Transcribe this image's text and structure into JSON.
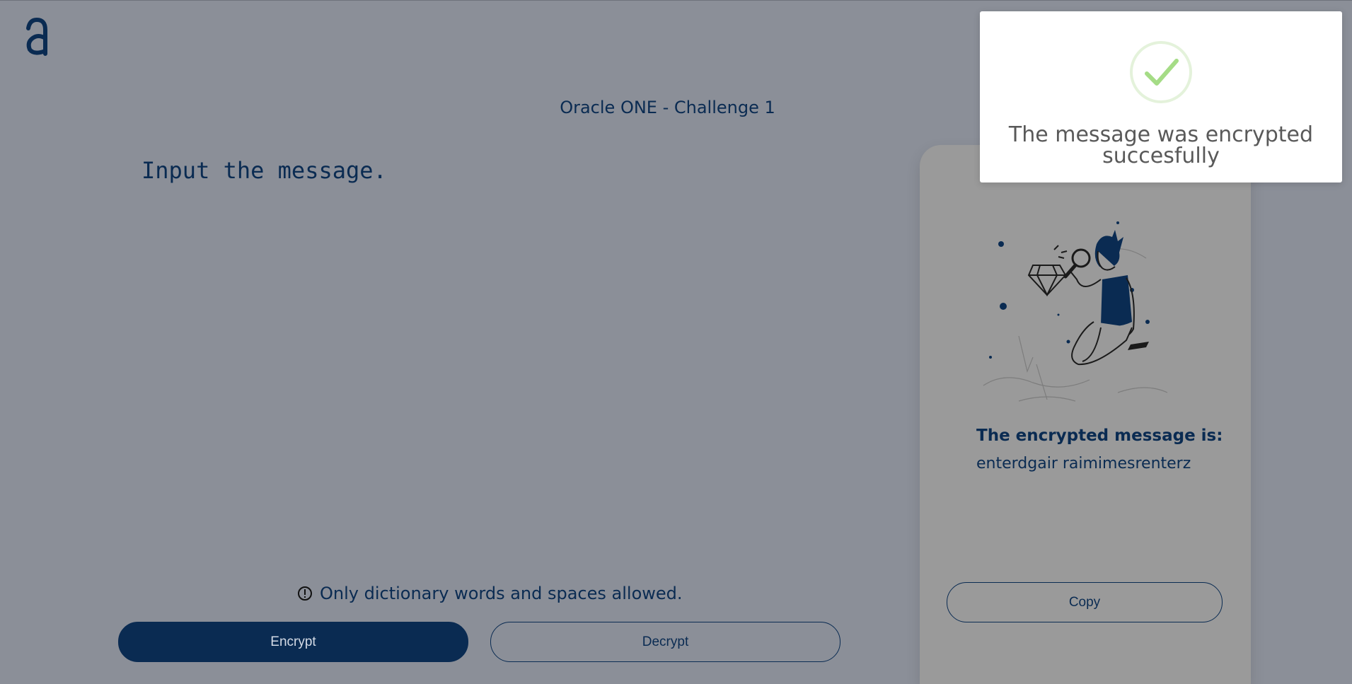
{
  "header": {
    "logo_icon": "alura-logo-icon",
    "title": "Oracle ONE - Challenge 1"
  },
  "input": {
    "placeholder": "Input the message.",
    "value": ""
  },
  "hint": {
    "icon": "exclamation-circle-icon",
    "text": "Only dictionary words and spaces allowed."
  },
  "actions": {
    "encrypt_label": "Encrypt",
    "decrypt_label": "Decrypt"
  },
  "result": {
    "illustration": "person-inspecting-diamond-illustration",
    "title": "The encrypted message is:",
    "text": "enterdgair raimimesrenterz",
    "copy_label": "Copy"
  },
  "toast": {
    "icon": "success-check-icon",
    "message": "The message was encrypted succesfully"
  },
  "colors": {
    "primary": "#0a2b52",
    "overlay_background": "#8b8f98",
    "panel_background": "#9a9a9a",
    "success": "#a5dc86"
  }
}
